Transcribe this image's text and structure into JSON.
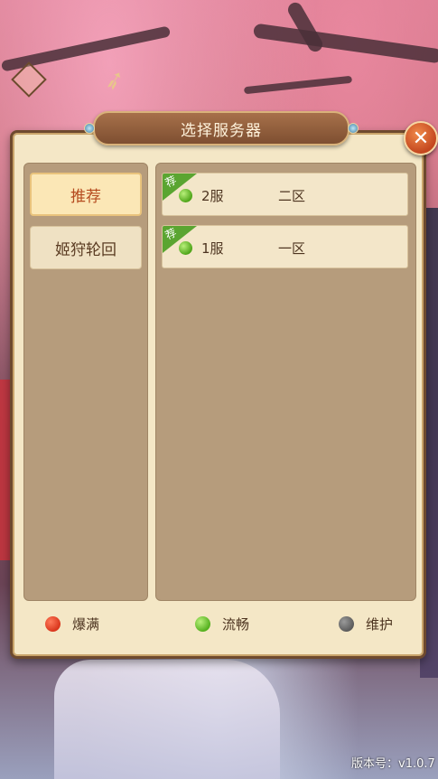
{
  "dialog": {
    "title": "选择服务器",
    "close_icon": "close-icon",
    "categories": [
      {
        "label": "推荐",
        "selected": true
      },
      {
        "label": "姬狩轮回",
        "selected": false
      }
    ],
    "servers": [
      {
        "badge": "荐",
        "name": "2服",
        "zone": "二区",
        "status": "流畅"
      },
      {
        "badge": "荐",
        "name": "1服",
        "zone": "一区",
        "status": "流畅"
      }
    ],
    "legend": [
      {
        "label": "爆满",
        "color": "#d9361c"
      },
      {
        "label": "流畅",
        "color": "#54b01e"
      },
      {
        "label": "维护",
        "color": "#5b5b5b"
      }
    ]
  },
  "footer": {
    "version": "版本号：v1.0.7"
  }
}
